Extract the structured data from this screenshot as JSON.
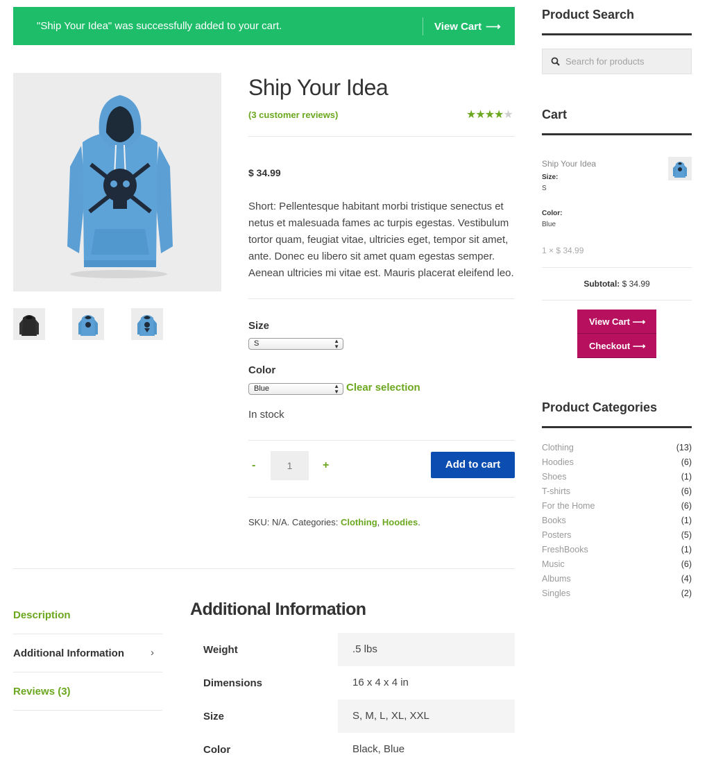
{
  "notice": {
    "message": "\"Ship Your Idea\" was successfully added to your cart.",
    "link_label": "View Cart",
    "link_arrow": "⟶"
  },
  "product": {
    "title": "Ship Your Idea",
    "reviews_link": "(3 customer reviews)",
    "rating": 4,
    "rating_max": 5,
    "price": "$ 34.99",
    "short_description": "Short: Pellentesque habitant morbi tristique senectus et netus et malesuada fames ac turpis egestas. Vestibulum tortor quam, feugiat vitae, ultricies eget, tempor sit amet, ante. Donec eu libero sit amet quam egestas semper. Aenean ultricies mi vitae est. Mauris placerat eleifend leo.",
    "size_label": "Size",
    "size_value": "S",
    "color_label": "Color",
    "color_value": "Blue",
    "clear_selection": "Clear selection",
    "stock": "In stock",
    "qty_minus": "-",
    "qty_value": "1",
    "qty_plus": "+",
    "add_to_cart": "Add to cart",
    "meta_prefix": "SKU: N/A. Categories: ",
    "categories": [
      "Clothing",
      "Hoodies"
    ],
    "meta_sep": ", ",
    "meta_end": "."
  },
  "gallery": {
    "main_image": "blue-skull-hoodie",
    "thumbnails": [
      "black-hoodie",
      "blue-hoodie-front",
      "blue-hoodie-back"
    ]
  },
  "tabs": {
    "items": [
      {
        "label": "Description"
      },
      {
        "label": "Additional Information"
      },
      {
        "label": "Reviews (3)"
      }
    ],
    "active": "Additional Information",
    "panel_title": "Additional Information",
    "rows": [
      {
        "name": "Weight",
        "value": ".5 lbs"
      },
      {
        "name": "Dimensions",
        "value": "16 x 4 x 4 in"
      },
      {
        "name": "Size",
        "value": "S, M, L, XL, XXL"
      },
      {
        "name": "Color",
        "value": "Black, Blue"
      }
    ]
  },
  "sidebar": {
    "search": {
      "title": "Product Search",
      "placeholder": "Search for products"
    },
    "cart": {
      "title": "Cart",
      "item_name": "Ship Your Idea",
      "size_label": "Size:",
      "size_value": "S",
      "color_label": "Color:",
      "color_value": "Blue",
      "qty_line": "1 × $ 34.99",
      "subtotal_label": "Subtotal:",
      "subtotal_value": " $ 34.99",
      "view_cart": "View Cart",
      "checkout": "Checkout",
      "arrow": "⟶"
    },
    "categories": {
      "title": "Product Categories",
      "items": [
        {
          "name": "Clothing",
          "count": "(13)"
        },
        {
          "name": "Hoodies",
          "count": "(6)"
        },
        {
          "name": "Shoes",
          "count": "(1)"
        },
        {
          "name": "T-shirts",
          "count": "(6)"
        },
        {
          "name": "For the Home",
          "count": "(6)"
        },
        {
          "name": "Books",
          "count": "(1)"
        },
        {
          "name": "Posters",
          "count": "(5)"
        },
        {
          "name": "FreshBooks",
          "count": "(1)"
        },
        {
          "name": "Music",
          "count": "(6)"
        },
        {
          "name": "Albums",
          "count": "(4)"
        },
        {
          "name": "Singles",
          "count": "(2)"
        }
      ]
    }
  },
  "colors": {
    "notice_green": "#1ebd6a",
    "link_green": "#6ba71f",
    "add_to_cart_blue": "#0c4db2",
    "cart_button_magenta": "#b6105e",
    "hoodie_blue": "#5b9fd4"
  }
}
